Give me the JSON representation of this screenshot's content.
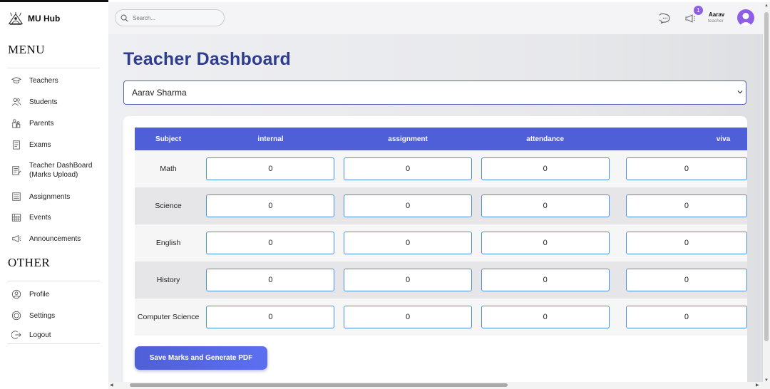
{
  "brand": {
    "name": "MU Hub"
  },
  "menu": {
    "title": "MENU",
    "items": [
      {
        "label": "Teachers",
        "icon": "graduation-cap-icon"
      },
      {
        "label": "Students",
        "icon": "users-icon"
      },
      {
        "label": "Parents",
        "icon": "parents-icon"
      },
      {
        "label": "Exams",
        "icon": "exam-icon"
      },
      {
        "label": "Teacher DashBoard (Marks Upload)",
        "icon": "upload-icon"
      },
      {
        "label": "Assignments",
        "icon": "assignment-icon"
      },
      {
        "label": "Events",
        "icon": "calendar-icon"
      },
      {
        "label": "Announcements",
        "icon": "megaphone-icon"
      }
    ]
  },
  "other": {
    "title": "OTHER",
    "items": [
      {
        "label": "Profile",
        "icon": "profile-icon"
      },
      {
        "label": "Settings",
        "icon": "settings-icon"
      },
      {
        "label": "Logout",
        "icon": "logout-icon"
      }
    ]
  },
  "topbar": {
    "search_placeholder": "Search...",
    "notification_count": "1",
    "user_name": "Aarav",
    "user_role": "teacher"
  },
  "page": {
    "title": "Teacher Dashboard",
    "selected_teacher": "Aarav Sharma"
  },
  "table": {
    "headers": [
      "Subject",
      "internal",
      "assignment",
      "attendance",
      "viva"
    ],
    "rows": [
      {
        "subject": "Math",
        "marks": [
          "0",
          "0",
          "0",
          "0"
        ]
      },
      {
        "subject": "Science",
        "marks": [
          "0",
          "0",
          "0",
          "0"
        ]
      },
      {
        "subject": "English",
        "marks": [
          "0",
          "0",
          "0",
          "0"
        ]
      },
      {
        "subject": "History",
        "marks": [
          "0",
          "0",
          "0",
          "0"
        ]
      },
      {
        "subject": "Computer Science",
        "marks": [
          "0",
          "0",
          "0",
          "0"
        ]
      }
    ]
  },
  "actions": {
    "save_label": "Save Marks and Generate PDF"
  },
  "colors": {
    "accent": "#4f5fd7",
    "title": "#2f3d8f",
    "badge": "#8e5fe6",
    "input_border": "#4b8fe0"
  }
}
